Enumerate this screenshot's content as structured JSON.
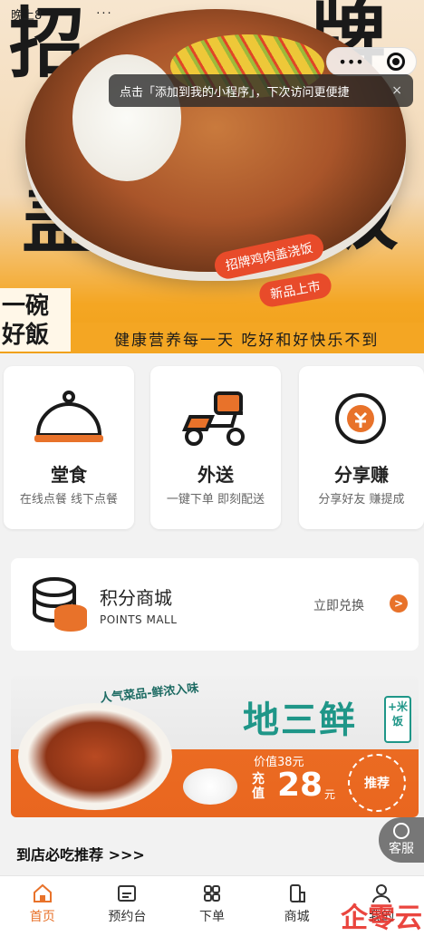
{
  "status_bar": {
    "time": "晚上8",
    "dots": "···",
    "right": ""
  },
  "hero": {
    "big_chars": [
      "招",
      "牌",
      "盖",
      "饭"
    ],
    "toast": {
      "text": "点击「添加到我的小程序」，下次访问更便捷",
      "close": "×"
    },
    "mp_menu": "•••",
    "dish_tag": "招牌鸡肉盖浇饭",
    "new_tag": "新品上市",
    "one_bowl": "一碗好飯",
    "slogan": "健康营养每一天 吃好和好快乐不到"
  },
  "services": [
    {
      "title": "堂食",
      "sub": "在线点餐  线下点餐",
      "icon": "cloche-icon"
    },
    {
      "title": "外送",
      "sub": "一键下单  即刻配送",
      "icon": "scooter-icon"
    },
    {
      "title": "分享赚",
      "sub": "分享好友  赚提成",
      "icon": "share-money-icon"
    }
  ],
  "points_mall": {
    "title": "积分商城",
    "subtitle": "POINTS MALL",
    "action": "立即兑换",
    "arrow": ">"
  },
  "promo": {
    "tagline": "人气菜品-鲜浓入味",
    "dish": "地三鲜",
    "addon": "+米饭",
    "old_price": "价值38元",
    "price_label": "充值",
    "price": "28",
    "unit": "元",
    "seal": "推荐"
  },
  "section_title": "到店必吃推荐 >>>",
  "customer_service": {
    "label": "客服"
  },
  "tabbar": [
    {
      "label": "首页",
      "icon": "home-icon",
      "active": true
    },
    {
      "label": "预约台",
      "icon": "calendar-icon",
      "active": false
    },
    {
      "label": "下单",
      "icon": "grid-icon",
      "active": false
    },
    {
      "label": "商城",
      "icon": "shop-icon",
      "active": false
    },
    {
      "label": "我的",
      "icon": "user-icon",
      "active": false
    }
  ],
  "watermark": "企零云",
  "colors": {
    "accent": "#e8722a",
    "banner_yellow": "#f4a623",
    "teal": "#1f9688",
    "red": "#e84b2a"
  }
}
